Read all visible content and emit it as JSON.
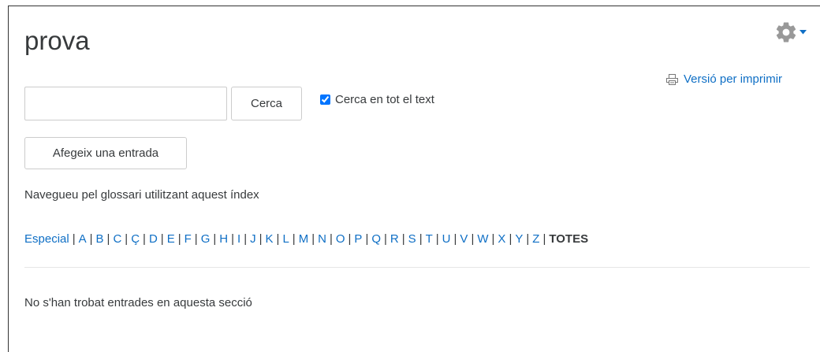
{
  "page": {
    "title": "prova"
  },
  "header": {
    "settings_icon": "gear-icon",
    "dropdown_icon": "caret-down-icon",
    "print_icon": "printer-icon",
    "print_link": "Versió per imprimir"
  },
  "search": {
    "value": "",
    "placeholder": "",
    "button_label": "Cerca",
    "fulltext_label": "Cerca en tot el text",
    "fulltext_checked": true
  },
  "actions": {
    "add_entry_label": "Afegeix una entrada"
  },
  "browse": {
    "description": "Navegueu pel glossari utilitzant aquest índex",
    "letters": [
      "Especial",
      "A",
      "B",
      "C",
      "Ç",
      "D",
      "E",
      "F",
      "G",
      "H",
      "I",
      "J",
      "K",
      "L",
      "M",
      "N",
      "O",
      "P",
      "Q",
      "R",
      "S",
      "T",
      "U",
      "V",
      "W",
      "X",
      "Y",
      "Z"
    ],
    "separator": "|",
    "current": "TOTES"
  },
  "results": {
    "empty_message": "No s'han trobat entrades en aquesta secció"
  },
  "colors": {
    "link": "#0f6fc5",
    "text": "#373a3c",
    "icon": "#999999"
  }
}
